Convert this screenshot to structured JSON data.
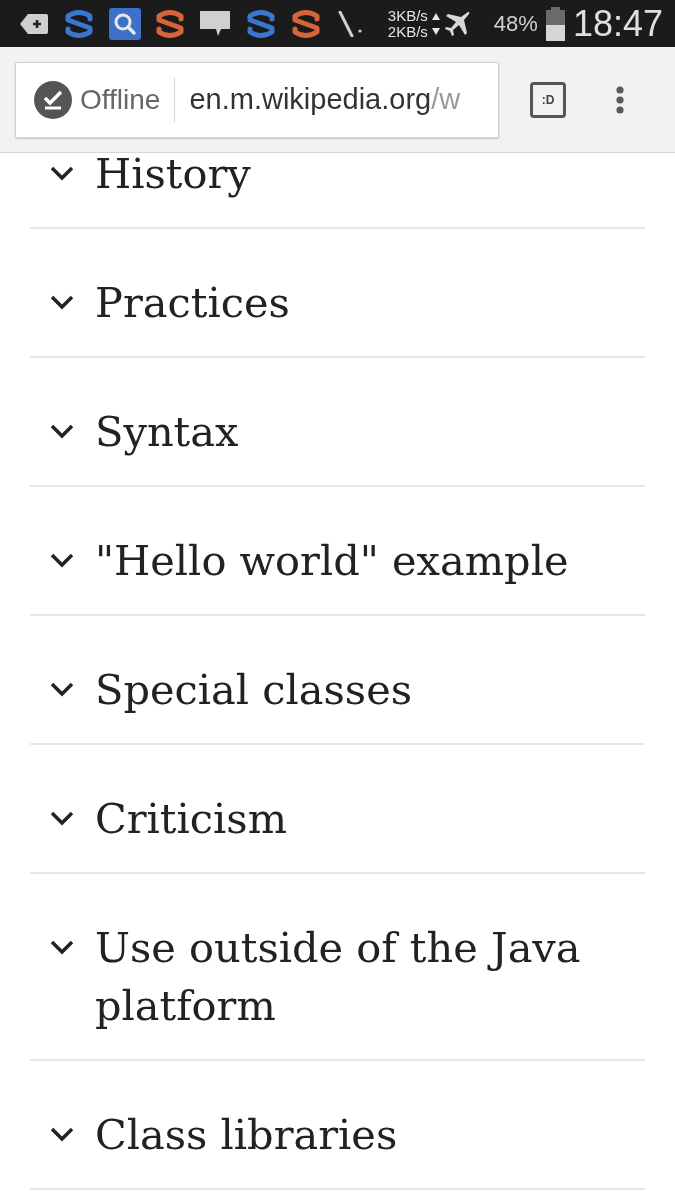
{
  "status_bar": {
    "speed_up": "3KB/s",
    "speed_down": "2KB/s",
    "battery": "48%",
    "time": "18:47"
  },
  "browser": {
    "offline_label": "Offline",
    "url_host": "en.m.wikipedia.org",
    "url_path": "/w",
    "extension_badge": ":D"
  },
  "sections": [
    {
      "title": "History",
      "expanded": false
    },
    {
      "title": "Practices",
      "expanded": false
    },
    {
      "title": "Syntax",
      "expanded": false
    },
    {
      "title": "\"Hello world\" example",
      "expanded": false
    },
    {
      "title": "Special classes",
      "expanded": false
    },
    {
      "title": "Criticism",
      "expanded": false
    },
    {
      "title": "Use outside of the Java platform",
      "expanded": false
    },
    {
      "title": "Class libraries",
      "expanded": false
    }
  ]
}
